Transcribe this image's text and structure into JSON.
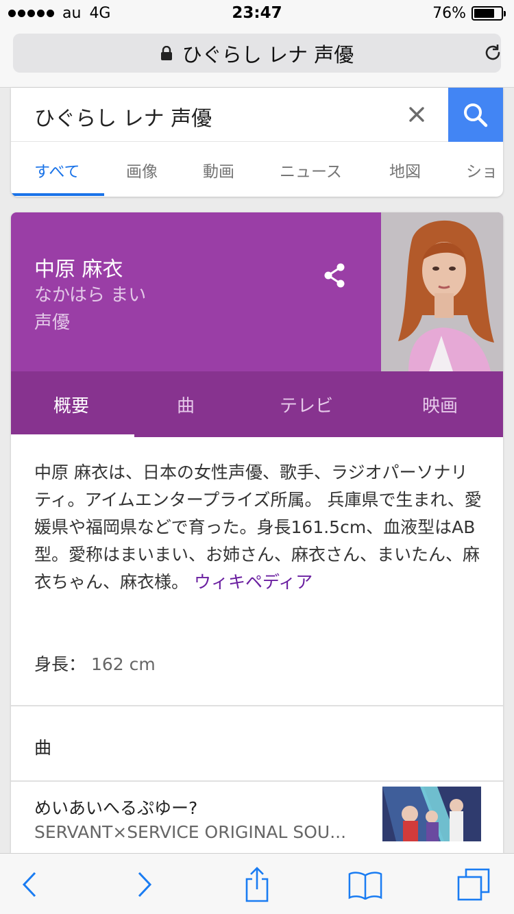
{
  "status_bar": {
    "carrier": "au",
    "network": "4G",
    "time": "23:47",
    "battery": "76%",
    "battery_level": 0.76
  },
  "browser": {
    "url_title": "ひぐらし レナ 声優"
  },
  "search": {
    "query": "ひぐらし レナ 声優",
    "tabs": [
      {
        "label": "すべて",
        "active": true
      },
      {
        "label": "画像"
      },
      {
        "label": "動画"
      },
      {
        "label": "ニュース"
      },
      {
        "label": "地図"
      },
      {
        "label": "ショ"
      }
    ]
  },
  "knowledge_panel": {
    "name": "中原 麻衣",
    "reading": "なかはら まい",
    "role": "声優",
    "tabs": [
      {
        "label": "概要",
        "active": true
      },
      {
        "label": "曲"
      },
      {
        "label": "テレビ"
      },
      {
        "label": "映画"
      }
    ],
    "description": "中原 麻衣は、日本の女性声優、歌手、ラジオパーソナリティ。アイムエンタープライズ所属。 兵庫県で生まれ、愛媛県や福岡県などで育った。身長161.5cm、血液型はAB型。愛称はまいまい、お姉さん、麻衣さん、まいたん、麻衣ちゃん、麻衣様。 ",
    "wiki_link": "ウィキペディア",
    "height_label": "身長：",
    "height_value": "162 cm",
    "songs_heading": "曲",
    "song": {
      "title": "めいあいへるぷゆー?",
      "album": "SERVANT×SERVICE ORIGINAL SOU..."
    }
  },
  "colors": {
    "kp_header": "#9a3ea6",
    "kp_tabs": "#87338f",
    "search_blue": "#4285f4",
    "ios_blue": "#1a7cf2"
  }
}
